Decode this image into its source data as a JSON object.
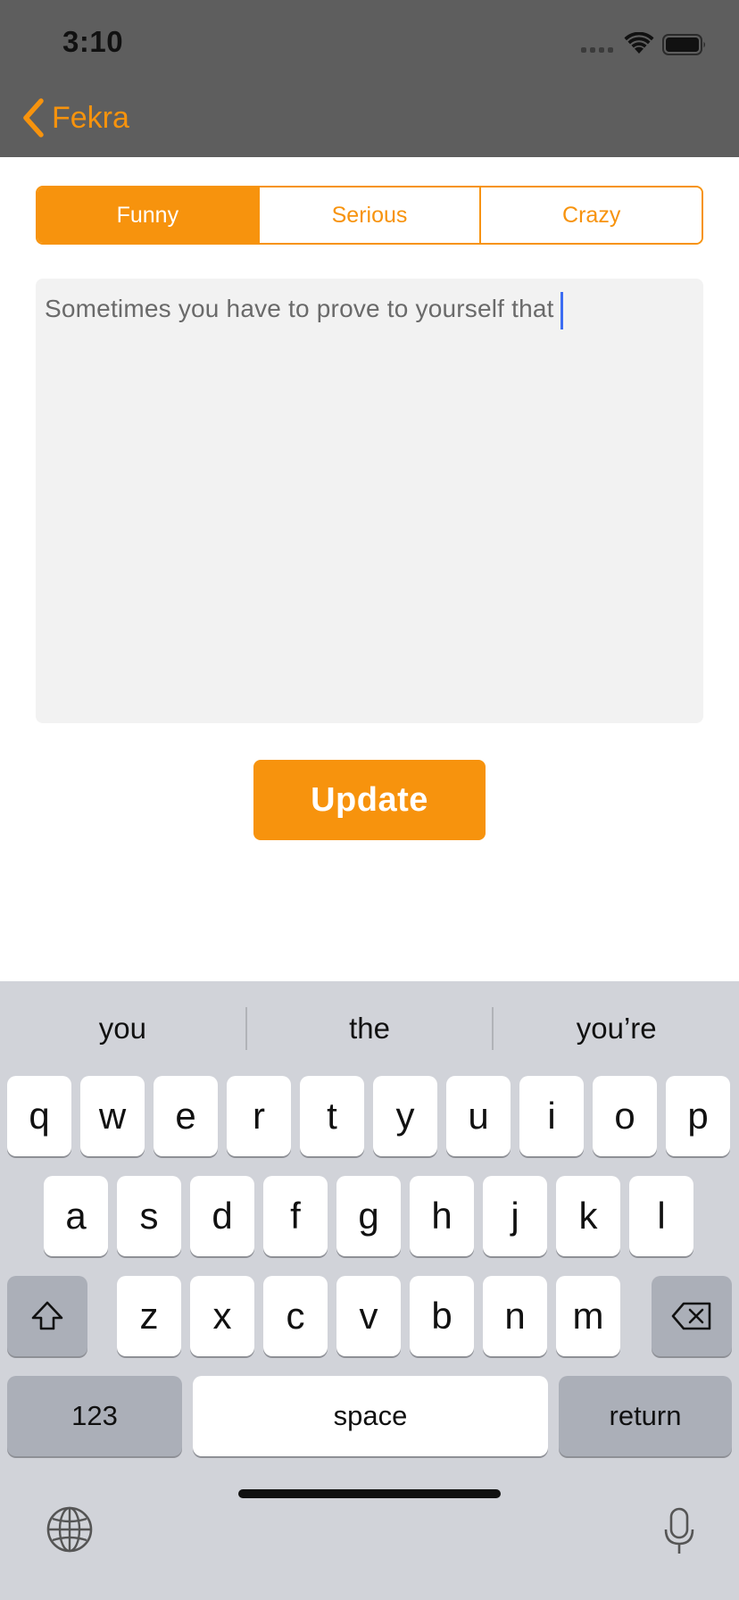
{
  "status_bar": {
    "time": "3:10"
  },
  "nav": {
    "back_label": "Fekra"
  },
  "segmented": {
    "options": [
      "Funny",
      "Serious",
      "Crazy"
    ],
    "selected": "Funny"
  },
  "editor": {
    "text": "Sometimes you have to prove to yourself that"
  },
  "actions": {
    "update_label": "Update"
  },
  "keyboard": {
    "suggestions": [
      "you",
      "the",
      "you’re"
    ],
    "row1": [
      "q",
      "w",
      "e",
      "r",
      "t",
      "y",
      "u",
      "i",
      "o",
      "p"
    ],
    "row2": [
      "a",
      "s",
      "d",
      "f",
      "g",
      "h",
      "j",
      "k",
      "l"
    ],
    "row3": [
      "z",
      "x",
      "c",
      "v",
      "b",
      "n",
      "m"
    ],
    "numbers_label": "123",
    "space_label": "space",
    "return_label": "return"
  },
  "colors": {
    "accent": "#f7930d",
    "nav_background": "#5e5e5e",
    "keyboard_background": "#d1d3d9"
  }
}
